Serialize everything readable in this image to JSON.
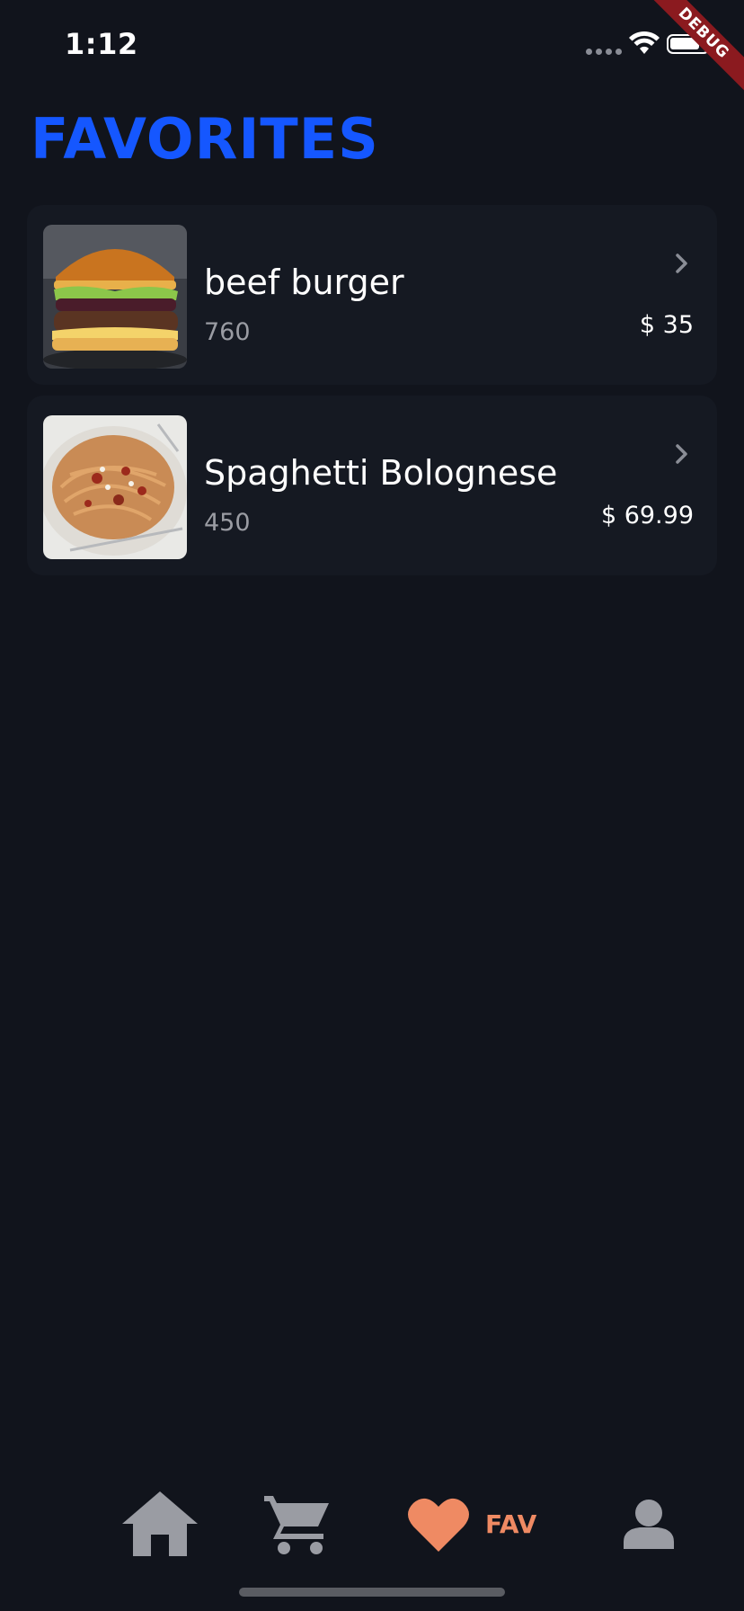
{
  "status_bar": {
    "time": "1:12",
    "debug_label": "DEBUG"
  },
  "page": {
    "title": "FAVORITES"
  },
  "favorites": [
    {
      "name": "beef burger",
      "calories": "760",
      "price": "$ 35",
      "image": "burger-image"
    },
    {
      "name": "Spaghetti Bolognese",
      "calories": "450",
      "price": "$ 69.99",
      "image": "spaghetti-image"
    }
  ],
  "bottom_nav": {
    "items": [
      {
        "icon": "home-icon",
        "label": ""
      },
      {
        "icon": "cart-icon",
        "label": ""
      },
      {
        "icon": "heart-icon",
        "label": "FAV",
        "active": true
      },
      {
        "icon": "person-icon",
        "label": ""
      }
    ]
  },
  "colors": {
    "background": "#11141c",
    "card": "#151922",
    "title": "#1557ff",
    "active_nav": "#ef8a63",
    "inactive_nav": "#9a9ca3"
  }
}
